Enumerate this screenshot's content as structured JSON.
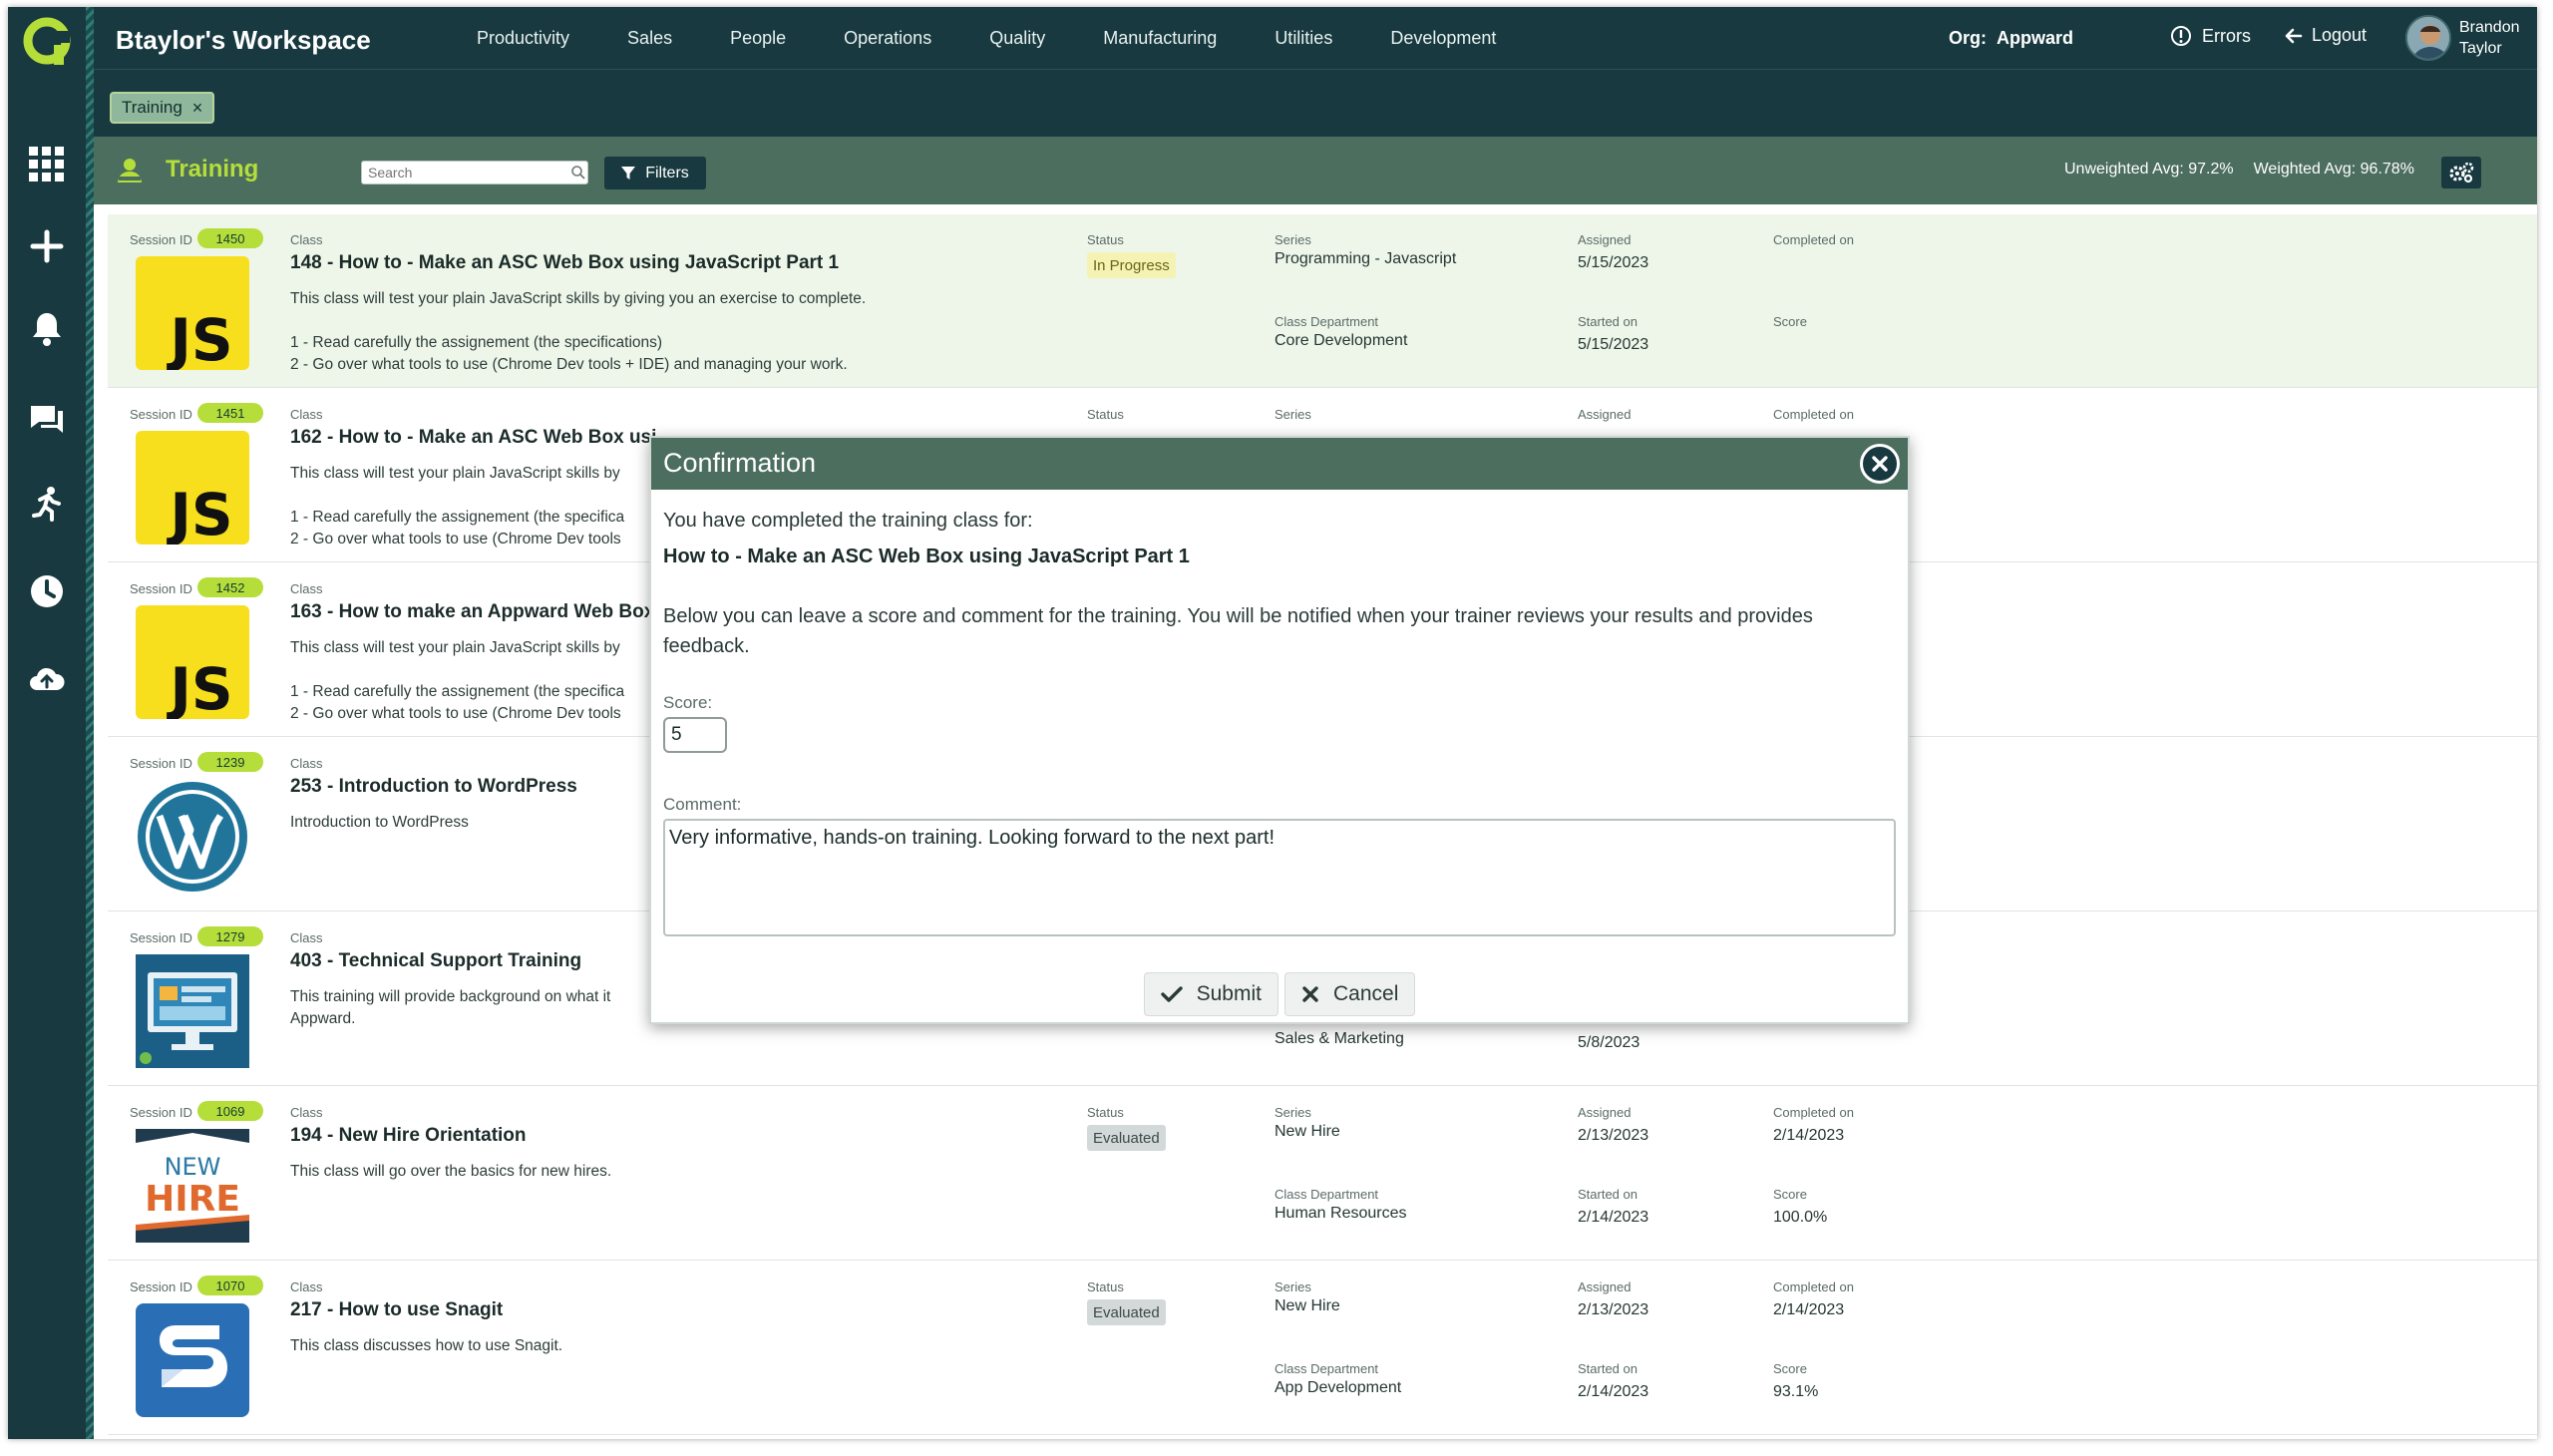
{
  "header": {
    "workspace_title": "Btaylor's Workspace",
    "nav": [
      "Productivity",
      "Sales",
      "People",
      "Operations",
      "Quality",
      "Manufacturing",
      "Utilities",
      "Development"
    ],
    "org_label": "Org:",
    "org_value": "Appward",
    "errors_label": "Errors",
    "logout_label": "Logout",
    "user_first": "Brandon",
    "user_last": "Taylor"
  },
  "breadcrumb": {
    "chip_label": "Training",
    "close_glyph": "×"
  },
  "toolbar": {
    "title": "Training",
    "search_placeholder": "Search",
    "filters_label": "Filters",
    "unweighted_avg": "Unweighted Avg: 97.2%",
    "weighted_avg": "Weighted Avg: 96.78%"
  },
  "labels": {
    "session_id": "Session ID",
    "class": "Class",
    "status": "Status",
    "series": "Series",
    "class_department": "Class Department",
    "assigned": "Assigned",
    "started_on": "Started on",
    "completed_on": "Completed on",
    "score": "Score"
  },
  "rows": [
    {
      "session_id": "1450",
      "icon": "javascript-logo",
      "title": "148 - How to - Make an ASC Web Box using JavaScript Part 1",
      "desc": "This class will test your plain JavaScript skills by giving you an exercise to complete.\n\n1 - Read carefully the assignement (the specifications)\n2 - Go over what tools to use (Chrome Dev tools + IDE) and managing your work.",
      "status": "In Progress",
      "series": "Programming - Javascript",
      "department": "Core Development",
      "assigned": "5/15/2023",
      "started": "5/15/2023",
      "completed": "",
      "score": ""
    },
    {
      "session_id": "1451",
      "icon": "javascript-logo",
      "title": "162 - How to - Make an ASC Web Box usi",
      "desc": "This class will test your plain JavaScript skills by\n\n1 - Read carefully the assignement (the specifica\n2 - Go over what tools to use (Chrome Dev tools",
      "status": "",
      "series": "",
      "department": "",
      "assigned": "",
      "started": "",
      "completed": "",
      "score": ""
    },
    {
      "session_id": "1452",
      "icon": "javascript-logo",
      "title": "163 - How to make an Appward Web Box",
      "desc": "This class will test your plain JavaScript skills by\n\n1 - Read carefully the assignement (the specifica\n2 - Go over what tools to use (Chrome Dev tools",
      "status": "",
      "series": "",
      "department": "",
      "assigned": "",
      "started": "",
      "completed": "",
      "score": ""
    },
    {
      "session_id": "1239",
      "icon": "wordpress-logo",
      "title": "253 - Introduction to WordPress",
      "desc": "Introduction to WordPress",
      "status": "",
      "series": "",
      "department": "",
      "assigned": "",
      "started": "",
      "completed": "",
      "score": ""
    },
    {
      "session_id": "1279",
      "icon": "monitor-dashboard-image",
      "title": "403 - Technical Support Training",
      "desc": "This training will provide background on what it\nAppward.",
      "status": "",
      "series": "",
      "department": "Sales & Marketing",
      "assigned": "",
      "started": "5/8/2023",
      "completed": "",
      "score": ""
    },
    {
      "session_id": "1069",
      "icon": "new-hire-image",
      "title": "194 - New Hire Orientation",
      "desc": "This class will go over the basics for new hires.",
      "status": "Evaluated",
      "series": "New Hire",
      "department": "Human Resources",
      "assigned": "2/13/2023",
      "started": "2/14/2023",
      "completed": "2/14/2023",
      "score": "100.0%"
    },
    {
      "session_id": "1070",
      "icon": "snagit-logo",
      "title": "217 - How to use Snagit",
      "desc": "This class discusses how to use Snagit.",
      "status": "Evaluated",
      "series": "New Hire",
      "department": "App Development",
      "assigned": "2/13/2023",
      "started": "2/14/2023",
      "completed": "2/14/2023",
      "score": "93.1%"
    }
  ],
  "thumb_text": {
    "js": "JS",
    "new": "NEW",
    "hire": "HIRE"
  },
  "modal": {
    "title": "Confirmation",
    "line1": "You have completed the training class for:",
    "class_name": "How to - Make an ASC Web Box using JavaScript Part 1",
    "paragraph": "Below you can leave a score and comment for the training. You will be notified when your trainer reviews your results and provides feedback.",
    "score_label": "Score:",
    "score_value": "5",
    "comment_label": "Comment:",
    "comment_value": "Very informative, hands-on training. Looking forward to the next part!",
    "submit_label": "Submit",
    "cancel_label": "Cancel"
  },
  "colors": {
    "dark_teal": "#17393f",
    "toolbar_green": "#4c6e5e",
    "accent_lime": "#b5de3a",
    "js_yellow": "#f7df1e",
    "wordpress_blue": "#21759b",
    "snagit_blue": "#2a6fb5",
    "new_hire_orange": "#e0692e"
  }
}
